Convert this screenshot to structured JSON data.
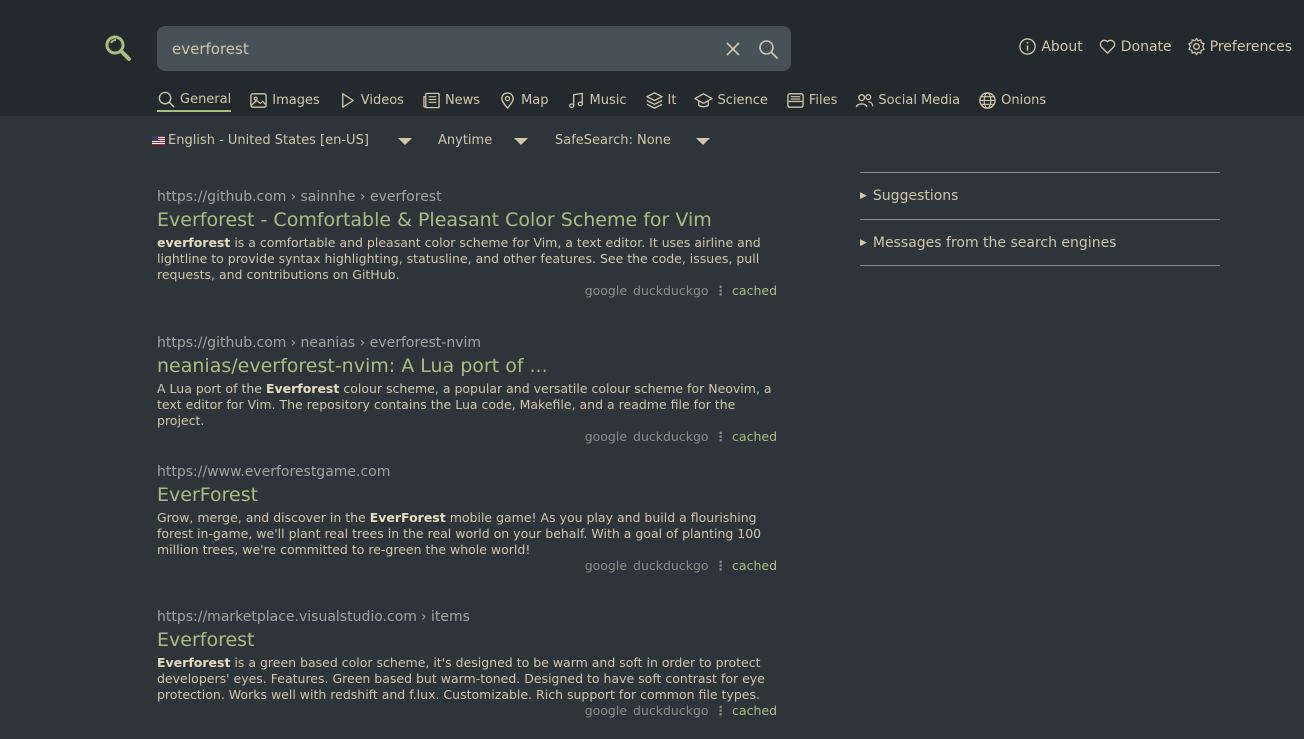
{
  "search": {
    "query": "everforest"
  },
  "top_links": [
    {
      "label": "About",
      "icon": "info-icon"
    },
    {
      "label": "Donate",
      "icon": "heart-icon"
    },
    {
      "label": "Preferences",
      "icon": "gear-icon"
    }
  ],
  "tabs": [
    {
      "label": "General",
      "icon": "search-icon",
      "active": true
    },
    {
      "label": "Images",
      "icon": "image-icon"
    },
    {
      "label": "Videos",
      "icon": "play-icon"
    },
    {
      "label": "News",
      "icon": "newspaper-icon"
    },
    {
      "label": "Map",
      "icon": "map-pin-icon"
    },
    {
      "label": "Music",
      "icon": "music-icon"
    },
    {
      "label": "It",
      "icon": "layers-icon"
    },
    {
      "label": "Science",
      "icon": "graduation-cap-icon"
    },
    {
      "label": "Files",
      "icon": "archive-icon"
    },
    {
      "label": "Social Media",
      "icon": "people-icon"
    },
    {
      "label": "Onions",
      "icon": "globe-icon"
    }
  ],
  "filters": {
    "language": "English - United States [en-US]",
    "time": "Anytime",
    "safesearch": "SafeSearch: None"
  },
  "results": [
    {
      "url": "https://github.com",
      "crumbs": "› sainnhe › everforest",
      "title": "Everforest - Comfortable & Pleasant Color Scheme for Vim",
      "snippet_bold": "everforest",
      "snippet_pre": "",
      "snippet_post": " is a comfortable and pleasant color scheme for Vim, a text editor. It uses airline and lightline to provide syntax highlighting, statusline, and other features. See the code, issues, pull requests, and contributions on GitHub.",
      "engine1": "google",
      "engine2": "duckduckgo",
      "cached": "cached"
    },
    {
      "url": "https://github.com",
      "crumbs": "› neanias › everforest-nvim",
      "title": "neanias/everforest-nvim: A Lua port of ...",
      "snippet_pre": "A Lua port of the ",
      "snippet_bold": "Everforest",
      "snippet_post": " colour scheme, a popular and versatile colour scheme for Neovim, a text editor for Vim. The repository contains the Lua code, Makefile, and a readme file for the project.",
      "engine1": "google",
      "engine2": "duckduckgo",
      "cached": "cached"
    },
    {
      "url": "https://www.everforestgame.com",
      "crumbs": "",
      "title": "EverForest",
      "snippet_pre": "Grow, merge, and discover in the ",
      "snippet_bold": "EverForest",
      "snippet_post": " mobile game! As you play and build a flourishing forest in-game, we'll plant real trees in the real world on your behalf. With a goal of planting 100 million trees, we're committed to re-green the whole world!",
      "engine1": "google",
      "engine2": "duckduckgo",
      "cached": "cached"
    },
    {
      "url": "https://marketplace.visualstudio.com",
      "crumbs": "› items",
      "title": "Everforest",
      "snippet_pre": "",
      "snippet_bold": "Everforest",
      "snippet_post": " is a green based color scheme, it's designed to be warm and soft in order to protect developers' eyes. Features. Green based but warm-toned. Designed to have soft contrast for eye protection. Works well with redshift and f.lux. Customizable. Rich support for common file types.",
      "engine1": "google",
      "engine2": "duckduckgo",
      "cached": "cached"
    }
  ],
  "sidebar": {
    "suggestions": "Suggestions",
    "messages": "Messages from the search engines"
  },
  "colors": {
    "accent": "#a7c080",
    "background": "#2d353b",
    "header": "#232a2e",
    "text": "#d3c6aa"
  }
}
